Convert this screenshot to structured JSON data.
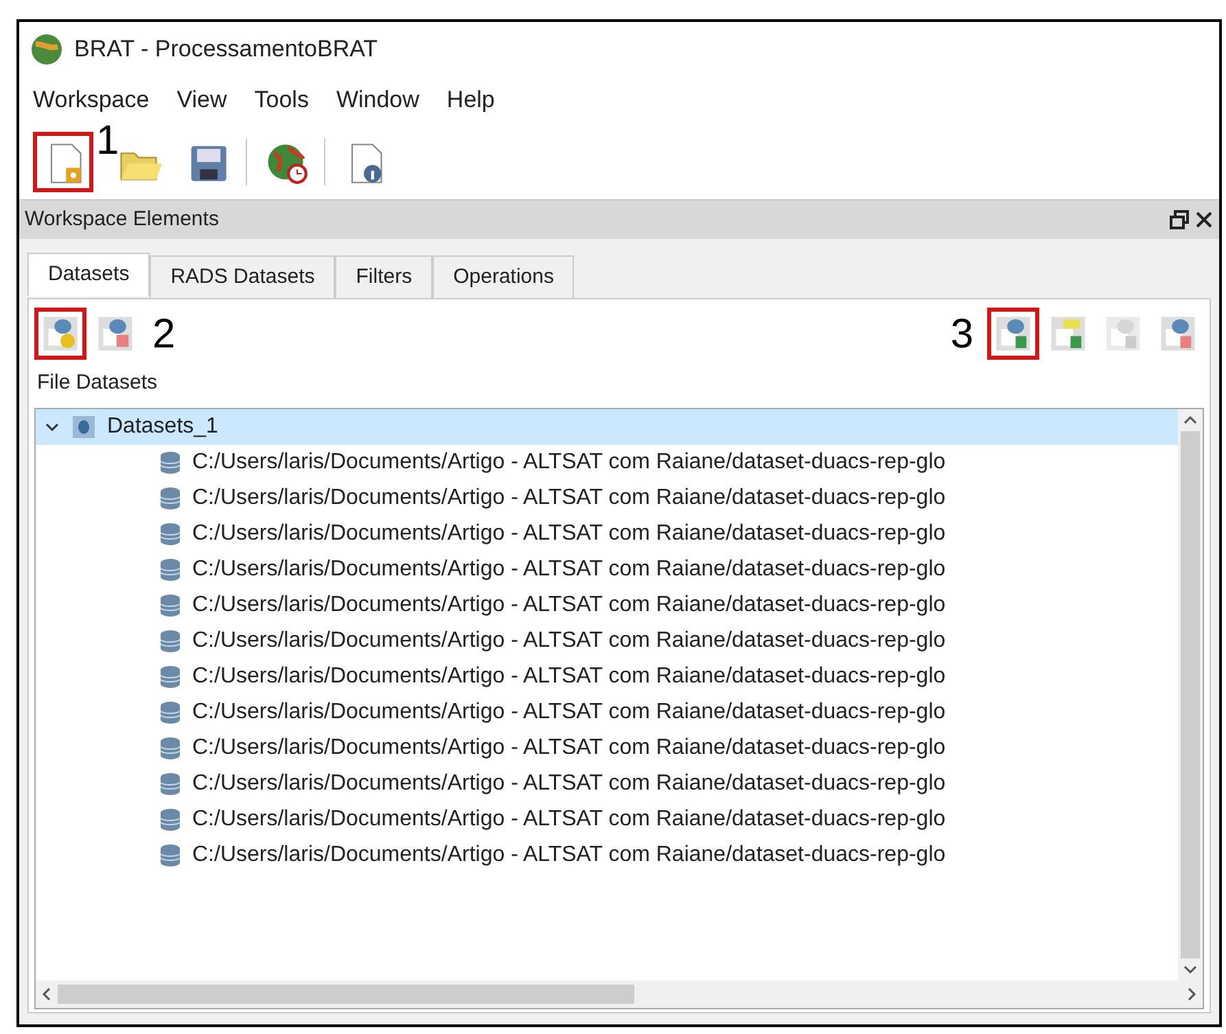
{
  "window": {
    "title": "BRAT - ProcessamentoBRAT"
  },
  "menu": [
    "Workspace",
    "View",
    "Tools",
    "Window",
    "Help"
  ],
  "toolbar": {
    "buttons": [
      {
        "kind": "new",
        "highlighted": true
      },
      {
        "kind": "open",
        "highlighted": false
      },
      {
        "kind": "save",
        "highlighted": false
      },
      {
        "kind": "globe",
        "highlighted": false
      },
      {
        "kind": "info",
        "highlighted": false
      }
    ],
    "annotation": "1"
  },
  "panel": {
    "title": "Workspace Elements",
    "tabs": [
      {
        "label": "Datasets",
        "selected": true
      },
      {
        "label": "RADS Datasets",
        "selected": false
      },
      {
        "label": "Filters",
        "selected": false
      },
      {
        "label": "Operations",
        "selected": false
      }
    ],
    "left_buttons": [
      {
        "kind": "add",
        "highlighted": true
      },
      {
        "kind": "delete",
        "highlighted": false
      }
    ],
    "left_annotation": "2",
    "right_annotation": "3",
    "right_buttons": [
      {
        "kind": "add-file",
        "highlighted": true,
        "disabled": false
      },
      {
        "kind": "add-folder",
        "highlighted": false,
        "disabled": false
      },
      {
        "kind": "remove-file",
        "highlighted": false,
        "disabled": true
      },
      {
        "kind": "delete-file",
        "highlighted": false,
        "disabled": false
      }
    ],
    "group_label": "File Datasets",
    "tree": [
      {
        "label": "Datasets_1",
        "expanded": true,
        "selected": true,
        "children": [
          {
            "label": "C:/Users/laris/Documents/Artigo - ALTSAT com Raiane/dataset-duacs-rep-glo"
          },
          {
            "label": "C:/Users/laris/Documents/Artigo - ALTSAT com Raiane/dataset-duacs-rep-glo"
          },
          {
            "label": "C:/Users/laris/Documents/Artigo - ALTSAT com Raiane/dataset-duacs-rep-glo"
          },
          {
            "label": "C:/Users/laris/Documents/Artigo - ALTSAT com Raiane/dataset-duacs-rep-glo"
          },
          {
            "label": "C:/Users/laris/Documents/Artigo - ALTSAT com Raiane/dataset-duacs-rep-glo"
          },
          {
            "label": "C:/Users/laris/Documents/Artigo - ALTSAT com Raiane/dataset-duacs-rep-glo"
          },
          {
            "label": "C:/Users/laris/Documents/Artigo - ALTSAT com Raiane/dataset-duacs-rep-glo"
          },
          {
            "label": "C:/Users/laris/Documents/Artigo - ALTSAT com Raiane/dataset-duacs-rep-glo"
          },
          {
            "label": "C:/Users/laris/Documents/Artigo - ALTSAT com Raiane/dataset-duacs-rep-glo"
          },
          {
            "label": "C:/Users/laris/Documents/Artigo - ALTSAT com Raiane/dataset-duacs-rep-glo"
          },
          {
            "label": "C:/Users/laris/Documents/Artigo - ALTSAT com Raiane/dataset-duacs-rep-glo"
          },
          {
            "label": "C:/Users/laris/Documents/Artigo - ALTSAT com Raiane/dataset-duacs-rep-glo"
          }
        ]
      }
    ]
  }
}
